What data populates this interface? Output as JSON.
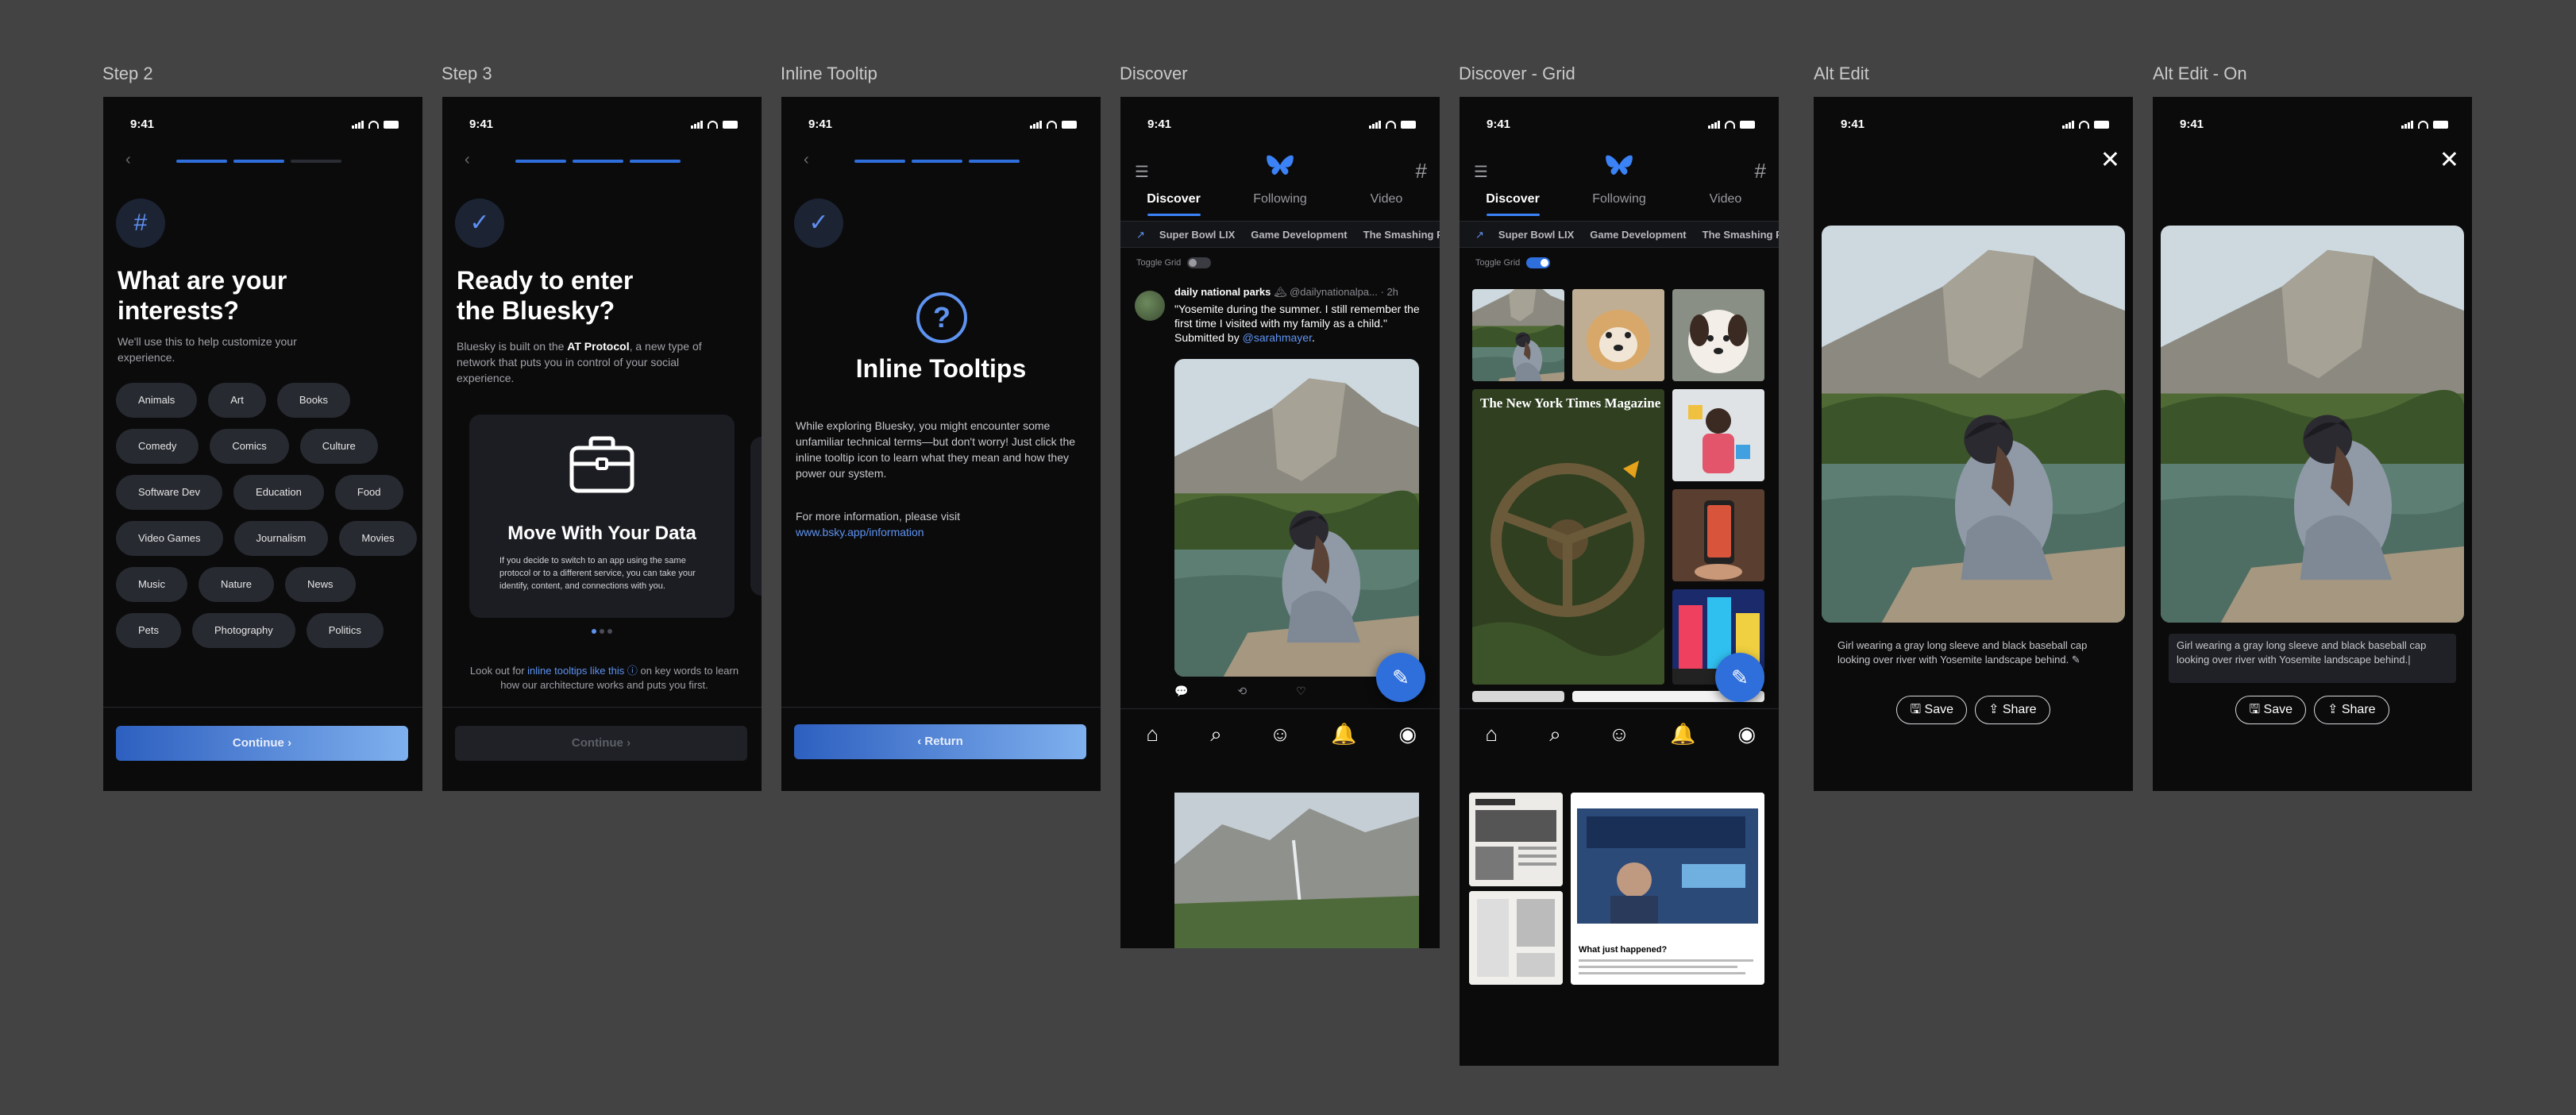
{
  "status_time": "9:41",
  "frames": {
    "step2": {
      "label": "Step 2",
      "icon": "#",
      "title_line1": "What are your",
      "title_line2": "interests?",
      "subtitle": "We'll use this to help customize your experience.",
      "chips": [
        "Animals",
        "Art",
        "Books",
        "Comedy",
        "Comics",
        "Culture",
        "Software Dev",
        "Education",
        "Food",
        "Video Games",
        "Journalism",
        "Movies",
        "Music",
        "Nature",
        "News",
        "Pets",
        "Photography",
        "Politics"
      ],
      "continue": "Continue"
    },
    "step3": {
      "label": "Step 3",
      "title_line1": "Ready to enter",
      "title_line2": "the Bluesky?",
      "sub_a": "Bluesky is built on the ",
      "sub_b": "AT Protocol",
      "sub_c": ", a new type of network that puts you in control of your social experience.",
      "card_title": "Move With Your Data",
      "card_body": "If you decide to switch to an app using the same protocol or to a different service, you can take your identify, content, and connections with you.",
      "foot_a": "Look out for ",
      "foot_link": "inline tooltips like this",
      "foot_b": " on key words to learn how our architecture works and puts you first.",
      "continue": "Continue"
    },
    "tooltip": {
      "label": "Inline Tooltip",
      "title": "Inline Tooltips",
      "body": "While exploring Bluesky, you might encounter some unfamiliar technical terms—but don't worry! Just click the inline tooltip icon to learn what they mean and how they power our system.",
      "info_a": "For more information, please visit ",
      "info_link": "www.bsky.app/information",
      "return": "Return"
    },
    "discover": {
      "label": "Discover",
      "tabs": [
        "Discover",
        "Following",
        "Video"
      ],
      "trends": [
        "Super Bowl LIX",
        "Game Development",
        "The Smashing Pu"
      ],
      "toggle_label": "Toggle Grid",
      "post_author": "daily national parks",
      "post_handle": "@dailynationalpa...",
      "post_time": "· 2h",
      "post_text_a": "\"Yosemite during the summer. I still remember the first time I visited with my family as a child.\" Submitted by ",
      "post_text_link": "@sarahmayer",
      "post_text_b": "."
    },
    "discover_grid": {
      "label": "Discover - Grid",
      "tabs": [
        "Discover",
        "Following",
        "Video"
      ],
      "trends": [
        "Super Bowl LIX",
        "Game Development",
        "The Smashing Pu"
      ],
      "toggle_label": "Toggle Grid",
      "magazine": "The New York Times Magazine",
      "article_heading": "What just happened?"
    },
    "alt_edit": {
      "label": "Alt Edit",
      "caption": "Girl wearing a gray long sleeve and black baseball cap looking over river with Yosemite landscape behind.",
      "save": "Save",
      "share": "Share"
    },
    "alt_edit_on": {
      "label": "Alt Edit - On",
      "caption": "Girl wearing a gray long sleeve and black baseball cap looking over river with Yosemite landscape behind.",
      "save": "Save",
      "share": "Share"
    }
  },
  "colors": {
    "accent": "#2f6fdc",
    "link": "#5e93f0",
    "background": "#434343",
    "frame": "#0b0b0c"
  }
}
